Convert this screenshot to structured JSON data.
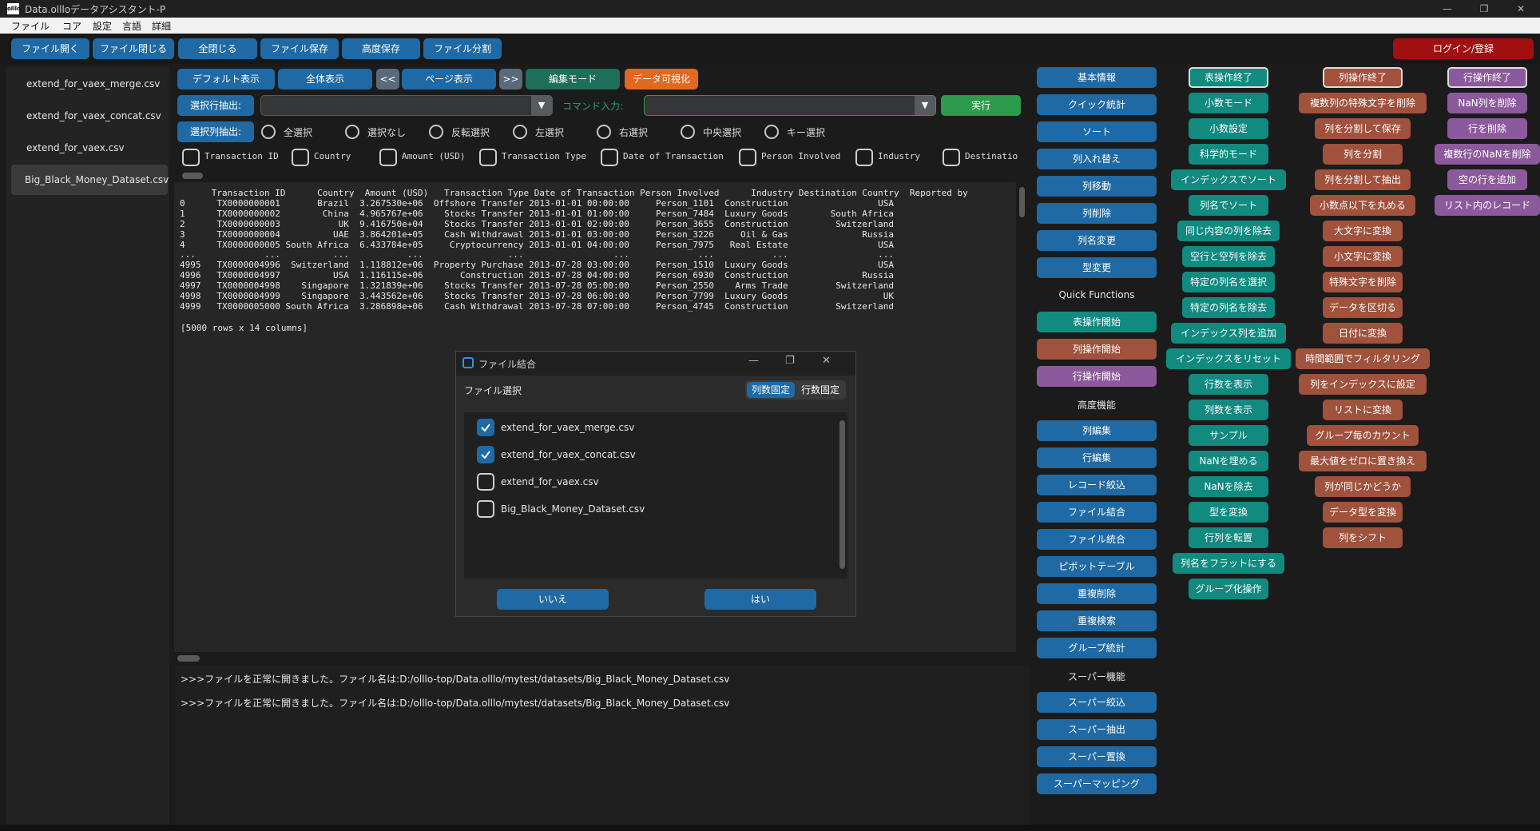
{
  "window": {
    "title": "Data.ollloデータアシスタント-P",
    "app_icon_text": "olllo",
    "controls": [
      "—",
      "❐",
      "✕"
    ]
  },
  "menu": [
    "ファイル",
    "コア",
    "設定",
    "言語",
    "詳細"
  ],
  "toolbar": [
    "ファイル開く",
    "ファイル閉じる",
    "全閉じる",
    "ファイル保存",
    "高度保存",
    "ファイル分割"
  ],
  "login_label": "ログイン/登録",
  "sidebar": [
    "extend_for_vaex_merge.csv",
    "extend_for_vaex_concat.csv",
    "extend_for_vaex.csv",
    "Big_Black_Money_Dataset.csv"
  ],
  "view_buttons": {
    "default": "デフォルト表示",
    "all": "全体表示",
    "prev": "<<",
    "page": "ページ表示",
    "next": ">>",
    "edit": "編集モード",
    "viz": "データ可視化"
  },
  "row_extract": {
    "label": "選択行抽出:",
    "command_label": "コマンド入力:",
    "run": "実行"
  },
  "col_select": {
    "label": "選択列抽出:",
    "options": [
      "全選択",
      "選択なし",
      "反転選択",
      "左選択",
      "右選択",
      "中央選択",
      "キー選択"
    ]
  },
  "columns": [
    "Transaction ID",
    "Country",
    "Amount (USD)",
    "Transaction Type",
    "Date of Transaction",
    "Person Involved",
    "Industry",
    "Destinatio"
  ],
  "table_text": "      Transaction ID      Country  Amount (USD)   Transaction Type Date of Transaction Person Involved      Industry Destination Country  Reported by\n0      TX0000000001       Brazil  3.267530e+06  Offshore Transfer 2013-01-01 00:00:00     Person_1101  Construction                 USA\n1      TX0000000002        China  4.965767e+06    Stocks Transfer 2013-01-01 01:00:00     Person_7484  Luxury Goods        South Africa\n2      TX0000000003           UK  9.416750e+04    Stocks Transfer 2013-01-01 02:00:00     Person_3655  Construction         Switzerland\n3      TX0000000004          UAE  3.864201e+05    Cash Withdrawal 2013-01-01 03:00:00     Person_3226     Oil & Gas              Russia\n4      TX0000000005 South Africa  6.433784e+05     Cryptocurrency 2013-01-01 04:00:00     Person_7975   Real Estate                 USA\n...             ...          ...           ...                ...                 ...             ...           ...                 ...\n4995   TX0000004996  Switzerland  1.118812e+06  Property Purchase 2013-07-28 03:00:00     Person_1510  Luxury Goods                 USA\n4996   TX0000004997          USA  1.116115e+06       Construction 2013-07-28 04:00:00     Person_6930  Construction              Russia\n4997   TX0000004998    Singapore  1.321839e+06    Stocks Transfer 2013-07-28 05:00:00     Person_2550    Arms Trade         Switzerland\n4998   TX0000004999    Singapore  3.443562e+06    Stocks Transfer 2013-07-28 06:00:00     Person_7799  Luxury Goods                  UK\n4999   TX0000005000 South Africa  3.286898e+06    Cash Withdrawal 2013-07-28 07:00:00     Person_4745  Construction         Switzerland",
  "rows_info": "[5000 rows x 14 columns]",
  "log": [
    ">>>ファイルを正常に開きました。ファイル名は:D:/olllo-top/Data.olllo/mytest/datasets/Big_Black_Money_Dataset.csv",
    ">>>ファイルを正常に開きました。ファイル名は:D:/olllo-top/Data.olllo/mytest/datasets/Big_Black_Money_Dataset.csv"
  ],
  "col1": {
    "basic": [
      "基本情報",
      "クイック統計",
      "ソート",
      "列入れ替え",
      "列移動",
      "列削除",
      "列名変更",
      "型変更"
    ],
    "quick_header": "Quick Functions",
    "quick": [
      "表操作開始",
      "列操作開始",
      "行操作開始"
    ],
    "advanced_header": "高度機能",
    "advanced": [
      "列編集",
      "行編集",
      "レコード絞込",
      "ファイル結合",
      "ファイル統合",
      "ピボットテーブル",
      "重複削除",
      "重複検索",
      "グループ統計"
    ],
    "super_header": "スーパー機能",
    "super": [
      "スーパー絞込",
      "スーパー抽出",
      "スーパー置換",
      "スーパーマッピング"
    ]
  },
  "col2": [
    "表操作終了",
    "小数モード",
    "小数設定",
    "科学的モード",
    "インデックスでソート",
    "列名でソート",
    "同じ内容の列を除去",
    "空行と空列を除去",
    "特定の列名を選択",
    "特定の列名を除去",
    "インデックス列を追加",
    "インデックスをリセット",
    "行数を表示",
    "列数を表示",
    "サンプル",
    "NaNを埋める",
    "NaNを除去",
    "型を変換",
    "行列を転置",
    "列名をフラットにする",
    "グループ化操作"
  ],
  "col3": [
    "列操作終了",
    "複数列の特殊文字を削除",
    "列を分割して保存",
    "列を分割",
    "列を分割して抽出",
    "小数点以下を丸める",
    "大文字に変換",
    "小文字に変換",
    "特殊文字を削除",
    "データを区切る",
    "日付に変換",
    "時間範囲でフィルタリング",
    "列をインデックスに設定",
    "リストに変換",
    "グループ毎のカウント",
    "最大値をゼロに置き換え",
    "列が同じかどうか",
    "データ型を変換",
    "列をシフト"
  ],
  "col4": [
    "行操作終了",
    "NaN列を削除",
    "行を削除",
    "複数行のNaNを削除",
    "空の行を追加",
    "リスト内のレコード"
  ],
  "dialog": {
    "title": "ファイル結合",
    "section": "ファイル選択",
    "mode_col": "列数固定",
    "mode_row": "行数固定",
    "files": [
      {
        "name": "extend_for_vaex_merge.csv",
        "checked": true
      },
      {
        "name": "extend_for_vaex_concat.csv",
        "checked": true
      },
      {
        "name": "extend_for_vaex.csv",
        "checked": false
      },
      {
        "name": "Big_Black_Money_Dataset.csv",
        "checked": false
      }
    ],
    "no": "いいえ",
    "yes": "はい"
  },
  "colors": {
    "blue": "#1f6aa5",
    "teal": "#118a80",
    "brown": "#a0523d",
    "purple": "#8c5a9c",
    "red": "#a01010",
    "orange": "#e0691f",
    "green": "#2c9c4c"
  }
}
